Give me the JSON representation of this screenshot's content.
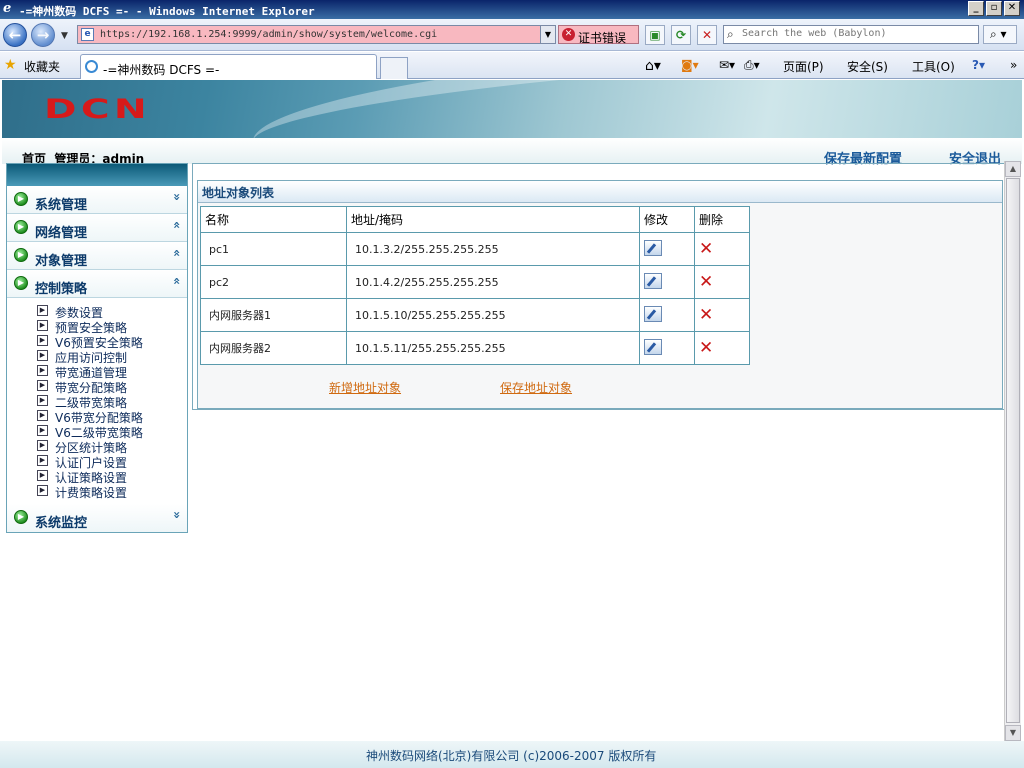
{
  "window": {
    "title": "-=神州数码 DCFS =- - Windows Internet Explorer",
    "minimize": "_",
    "maximize": "▫",
    "close": "✕"
  },
  "address_bar": {
    "url": "https://192.168.1.254:9999/admin/show/system/welcome.cgi",
    "cert_error": "证书错误",
    "search_placeholder": "Search the web (Babylon)"
  },
  "favorites_bar": {
    "favorites_label": "收藏夹",
    "active_tab": "-=神州数码 DCFS =-",
    "commands": [
      "页面(P)",
      "安全(S)",
      "工具(O)"
    ]
  },
  "header": {
    "logo": "DCN",
    "home": "首页",
    "admin_label": "管理员：admin",
    "save_config": "保存最新配置",
    "logout": "安全退出"
  },
  "sidebar": {
    "sections": [
      {
        "label": "系统管理",
        "chevron": "»"
      },
      {
        "label": "网络管理",
        "chevron": "«"
      },
      {
        "label": "对象管理",
        "chevron": "«"
      },
      {
        "label": "控制策略",
        "chevron": "«"
      },
      {
        "label": "系统监控",
        "chevron": "»"
      }
    ],
    "items": [
      "参数设置",
      "预置安全策略",
      "V6预置安全策略",
      "应用访问控制",
      "带宽通道管理",
      "带宽分配策略",
      "二级带宽策略",
      "V6带宽分配策略",
      "V6二级带宽策略",
      "分区统计策略",
      "认证门户设置",
      "认证策略设置",
      "计费策略设置"
    ]
  },
  "main": {
    "list_title": "地址对象列表",
    "columns": [
      "名称",
      "地址/掩码",
      "修改",
      "删除"
    ],
    "rows": [
      {
        "name": "pc1",
        "address": "10.1.3.2/255.255.255.255"
      },
      {
        "name": "pc2",
        "address": "10.1.4.2/255.255.255.255"
      },
      {
        "name": "内网服务器1",
        "address": "10.1.5.10/255.255.255.255"
      },
      {
        "name": "内网服务器2",
        "address": "10.1.5.11/255.255.255.255"
      }
    ],
    "add_link": "新增地址对象",
    "save_link": "保存地址对象"
  },
  "footer": {
    "copyright": "神州数码网络(北京)有限公司 (c)2006-2007 版权所有"
  }
}
